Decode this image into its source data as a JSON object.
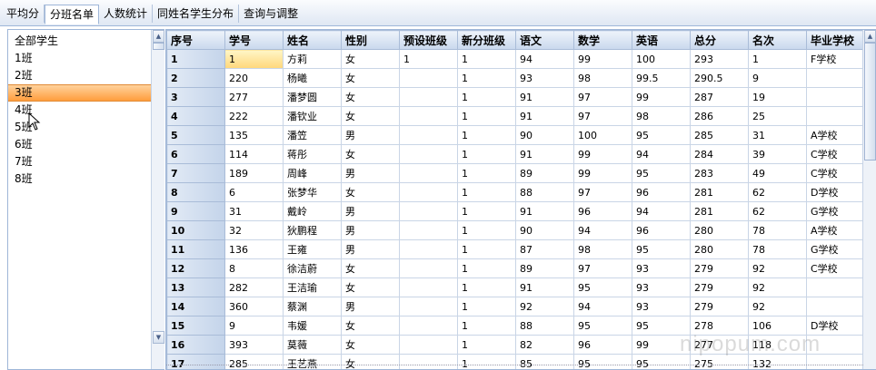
{
  "tabs": [
    {
      "label": "平均分",
      "active": false
    },
    {
      "label": "分班名单",
      "active": true
    },
    {
      "label": "人数统计",
      "active": false
    },
    {
      "label": "同姓名学生分布",
      "active": false
    },
    {
      "label": "查询与调整",
      "active": false
    }
  ],
  "sidebar": {
    "items": [
      "全部学生",
      "1班",
      "2班",
      "3班",
      "4班",
      "5班",
      "6班",
      "7班",
      "8班"
    ],
    "selected_index": 3
  },
  "grid": {
    "columns": [
      "序号",
      "学号",
      "姓名",
      "性别",
      "预设班级",
      "新分班级",
      "语文",
      "数学",
      "英语",
      "总分",
      "名次",
      "毕业学校"
    ],
    "rows": [
      [
        "1",
        "1",
        "方莉",
        "女",
        "1",
        "1",
        "94",
        "99",
        "100",
        "293",
        "1",
        "F学校"
      ],
      [
        "2",
        "220",
        "杨曦",
        "女",
        "",
        "1",
        "93",
        "98",
        "99.5",
        "290.5",
        "9",
        ""
      ],
      [
        "3",
        "277",
        "潘梦圆",
        "女",
        "",
        "1",
        "91",
        "97",
        "99",
        "287",
        "19",
        ""
      ],
      [
        "4",
        "222",
        "潘钦业",
        "女",
        "",
        "1",
        "91",
        "97",
        "98",
        "286",
        "25",
        ""
      ],
      [
        "5",
        "135",
        "潘笠",
        "男",
        "",
        "1",
        "90",
        "100",
        "95",
        "285",
        "31",
        "A学校"
      ],
      [
        "6",
        "114",
        "蒋彤",
        "女",
        "",
        "1",
        "91",
        "99",
        "94",
        "284",
        "39",
        "C学校"
      ],
      [
        "7",
        "189",
        "周峰",
        "男",
        "",
        "1",
        "89",
        "99",
        "95",
        "283",
        "49",
        "C学校"
      ],
      [
        "8",
        "6",
        "张梦华",
        "女",
        "",
        "1",
        "88",
        "97",
        "96",
        "281",
        "62",
        "D学校"
      ],
      [
        "9",
        "31",
        "戴岭",
        "男",
        "",
        "1",
        "91",
        "96",
        "94",
        "281",
        "62",
        "G学校"
      ],
      [
        "10",
        "32",
        "狄鹏程",
        "男",
        "",
        "1",
        "90",
        "94",
        "96",
        "280",
        "78",
        "A学校"
      ],
      [
        "11",
        "136",
        "王雍",
        "男",
        "",
        "1",
        "87",
        "98",
        "95",
        "280",
        "78",
        "G学校"
      ],
      [
        "12",
        "8",
        "徐洁蔚",
        "女",
        "",
        "1",
        "89",
        "97",
        "93",
        "279",
        "92",
        "C学校"
      ],
      [
        "13",
        "282",
        "王洁瑜",
        "女",
        "",
        "1",
        "91",
        "95",
        "93",
        "279",
        "92",
        ""
      ],
      [
        "14",
        "360",
        "蔡渊",
        "男",
        "",
        "1",
        "92",
        "94",
        "93",
        "279",
        "92",
        ""
      ],
      [
        "15",
        "9",
        "韦媛",
        "女",
        "",
        "1",
        "88",
        "95",
        "95",
        "278",
        "106",
        "D学校"
      ],
      [
        "16",
        "393",
        "莫薇",
        "女",
        "",
        "1",
        "82",
        "96",
        "99",
        "277",
        "118",
        ""
      ],
      [
        "17",
        "285",
        "王艺燕",
        "女",
        "",
        "1",
        "85",
        "95",
        "95",
        "275",
        "132",
        ""
      ]
    ]
  },
  "watermark": "nipopum.com",
  "colors": {
    "accent": "#ff9d3d",
    "header_bg": "#c9d8ed",
    "border": "#9eb6d8"
  }
}
